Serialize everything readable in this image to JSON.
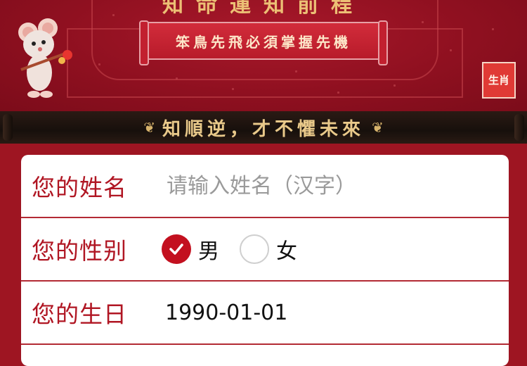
{
  "banner": {
    "heading": "知命運知前程",
    "scroll_text": "笨鳥先飛必須掌握先機",
    "seal_text": "生肖"
  },
  "slogan": "知順逆，才不懼未來",
  "form": {
    "name": {
      "label": "您的姓名",
      "value": "",
      "placeholder": "请输入姓名（汉字）"
    },
    "gender": {
      "label": "您的性别",
      "options": [
        {
          "label": "男",
          "checked": true
        },
        {
          "label": "女",
          "checked": false
        }
      ]
    },
    "birthday": {
      "label": "您的生日",
      "value": "1990-01-01"
    }
  },
  "colors": {
    "accent": "#c3101f",
    "label": "#b01623",
    "banner_bg": "#8f1020"
  }
}
